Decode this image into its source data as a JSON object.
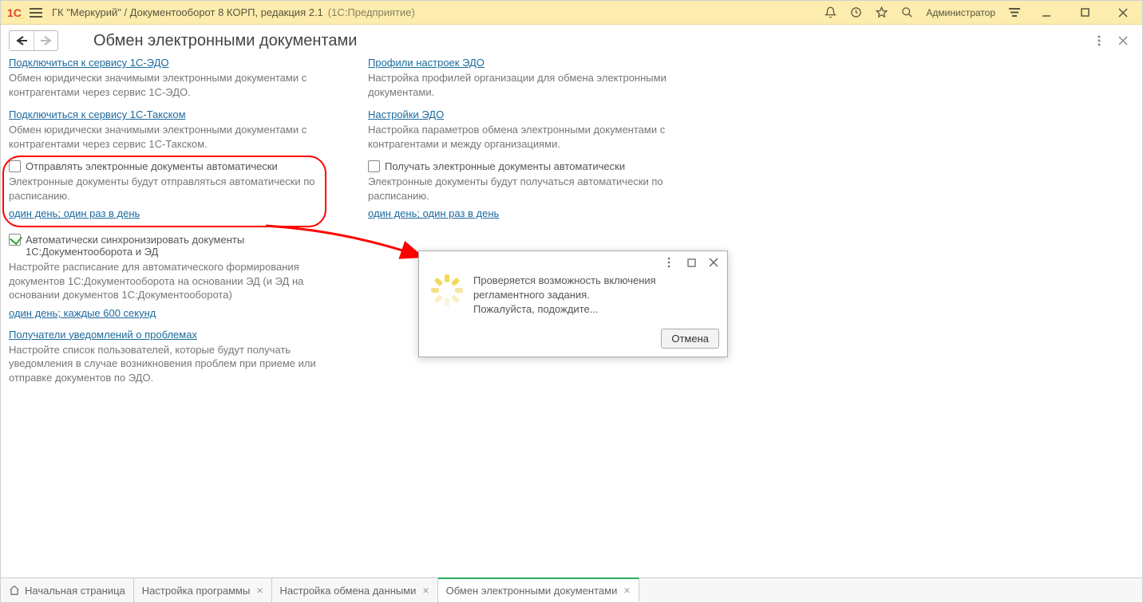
{
  "titlebar": {
    "title_primary": "ГК \"Меркурий\" / Документооборот 8 КОРП, редакция 2.1",
    "title_secondary": "(1С:Предприятие)",
    "user": "Администратор"
  },
  "page": {
    "title": "Обмен электронными документами"
  },
  "left": {
    "connect_edo": "Подключиться к сервису 1С-ЭДО",
    "connect_edo_desc": "Обмен юридически значимыми электронными документами с контрагентами через сервис 1С-ЭДО.",
    "connect_taxcom": "Подключиться к сервису 1С-Такском",
    "connect_taxcom_desc": "Обмен юридически значимыми электронными документами с контрагентами через сервис 1С-Такском.",
    "send_auto_label": "Отправлять электронные документы автоматически",
    "send_auto_desc": "Электронные документы будут отправляться автоматически по расписанию.",
    "send_schedule": "один день; один раз в день",
    "sync_label": "Автоматически синхронизировать документы 1С:Документооборота и ЭД",
    "sync_desc": "Настройте расписание для автоматического формирования документов 1С:Документооборота на основании ЭД (и ЭД на основании документов 1С:Документооборота)",
    "sync_schedule": "один день; каждые 600 секунд",
    "recipients": "Получатели уведомлений о проблемах",
    "recipients_desc": "Настройте список пользователей, которые будут получать уведомления в случае возникновения проблем при приеме или отправке документов по ЭДО."
  },
  "right": {
    "profiles": "Профили настроек ЭДО",
    "profiles_desc": "Настройка профилей организации для обмена электронными документами.",
    "settings": "Настройки ЭДО",
    "settings_desc": "Настройка параметров обмена электронными документами с контрагентами и между организациями.",
    "receive_auto_label": "Получать электронные документы автоматически",
    "receive_auto_desc": "Электронные документы будут получаться автоматически по расписанию.",
    "receive_schedule": "один день; один раз в день"
  },
  "dialog": {
    "line1": "Проверяется возможность включения",
    "line2": "регламентного задания.",
    "line3": "Пожалуйста, подождите...",
    "cancel": "Отмена"
  },
  "tabs": {
    "home": "Начальная страница",
    "t1": "Настройка программы",
    "t2": "Настройка обмена данными",
    "t3": "Обмен электронными документами"
  }
}
